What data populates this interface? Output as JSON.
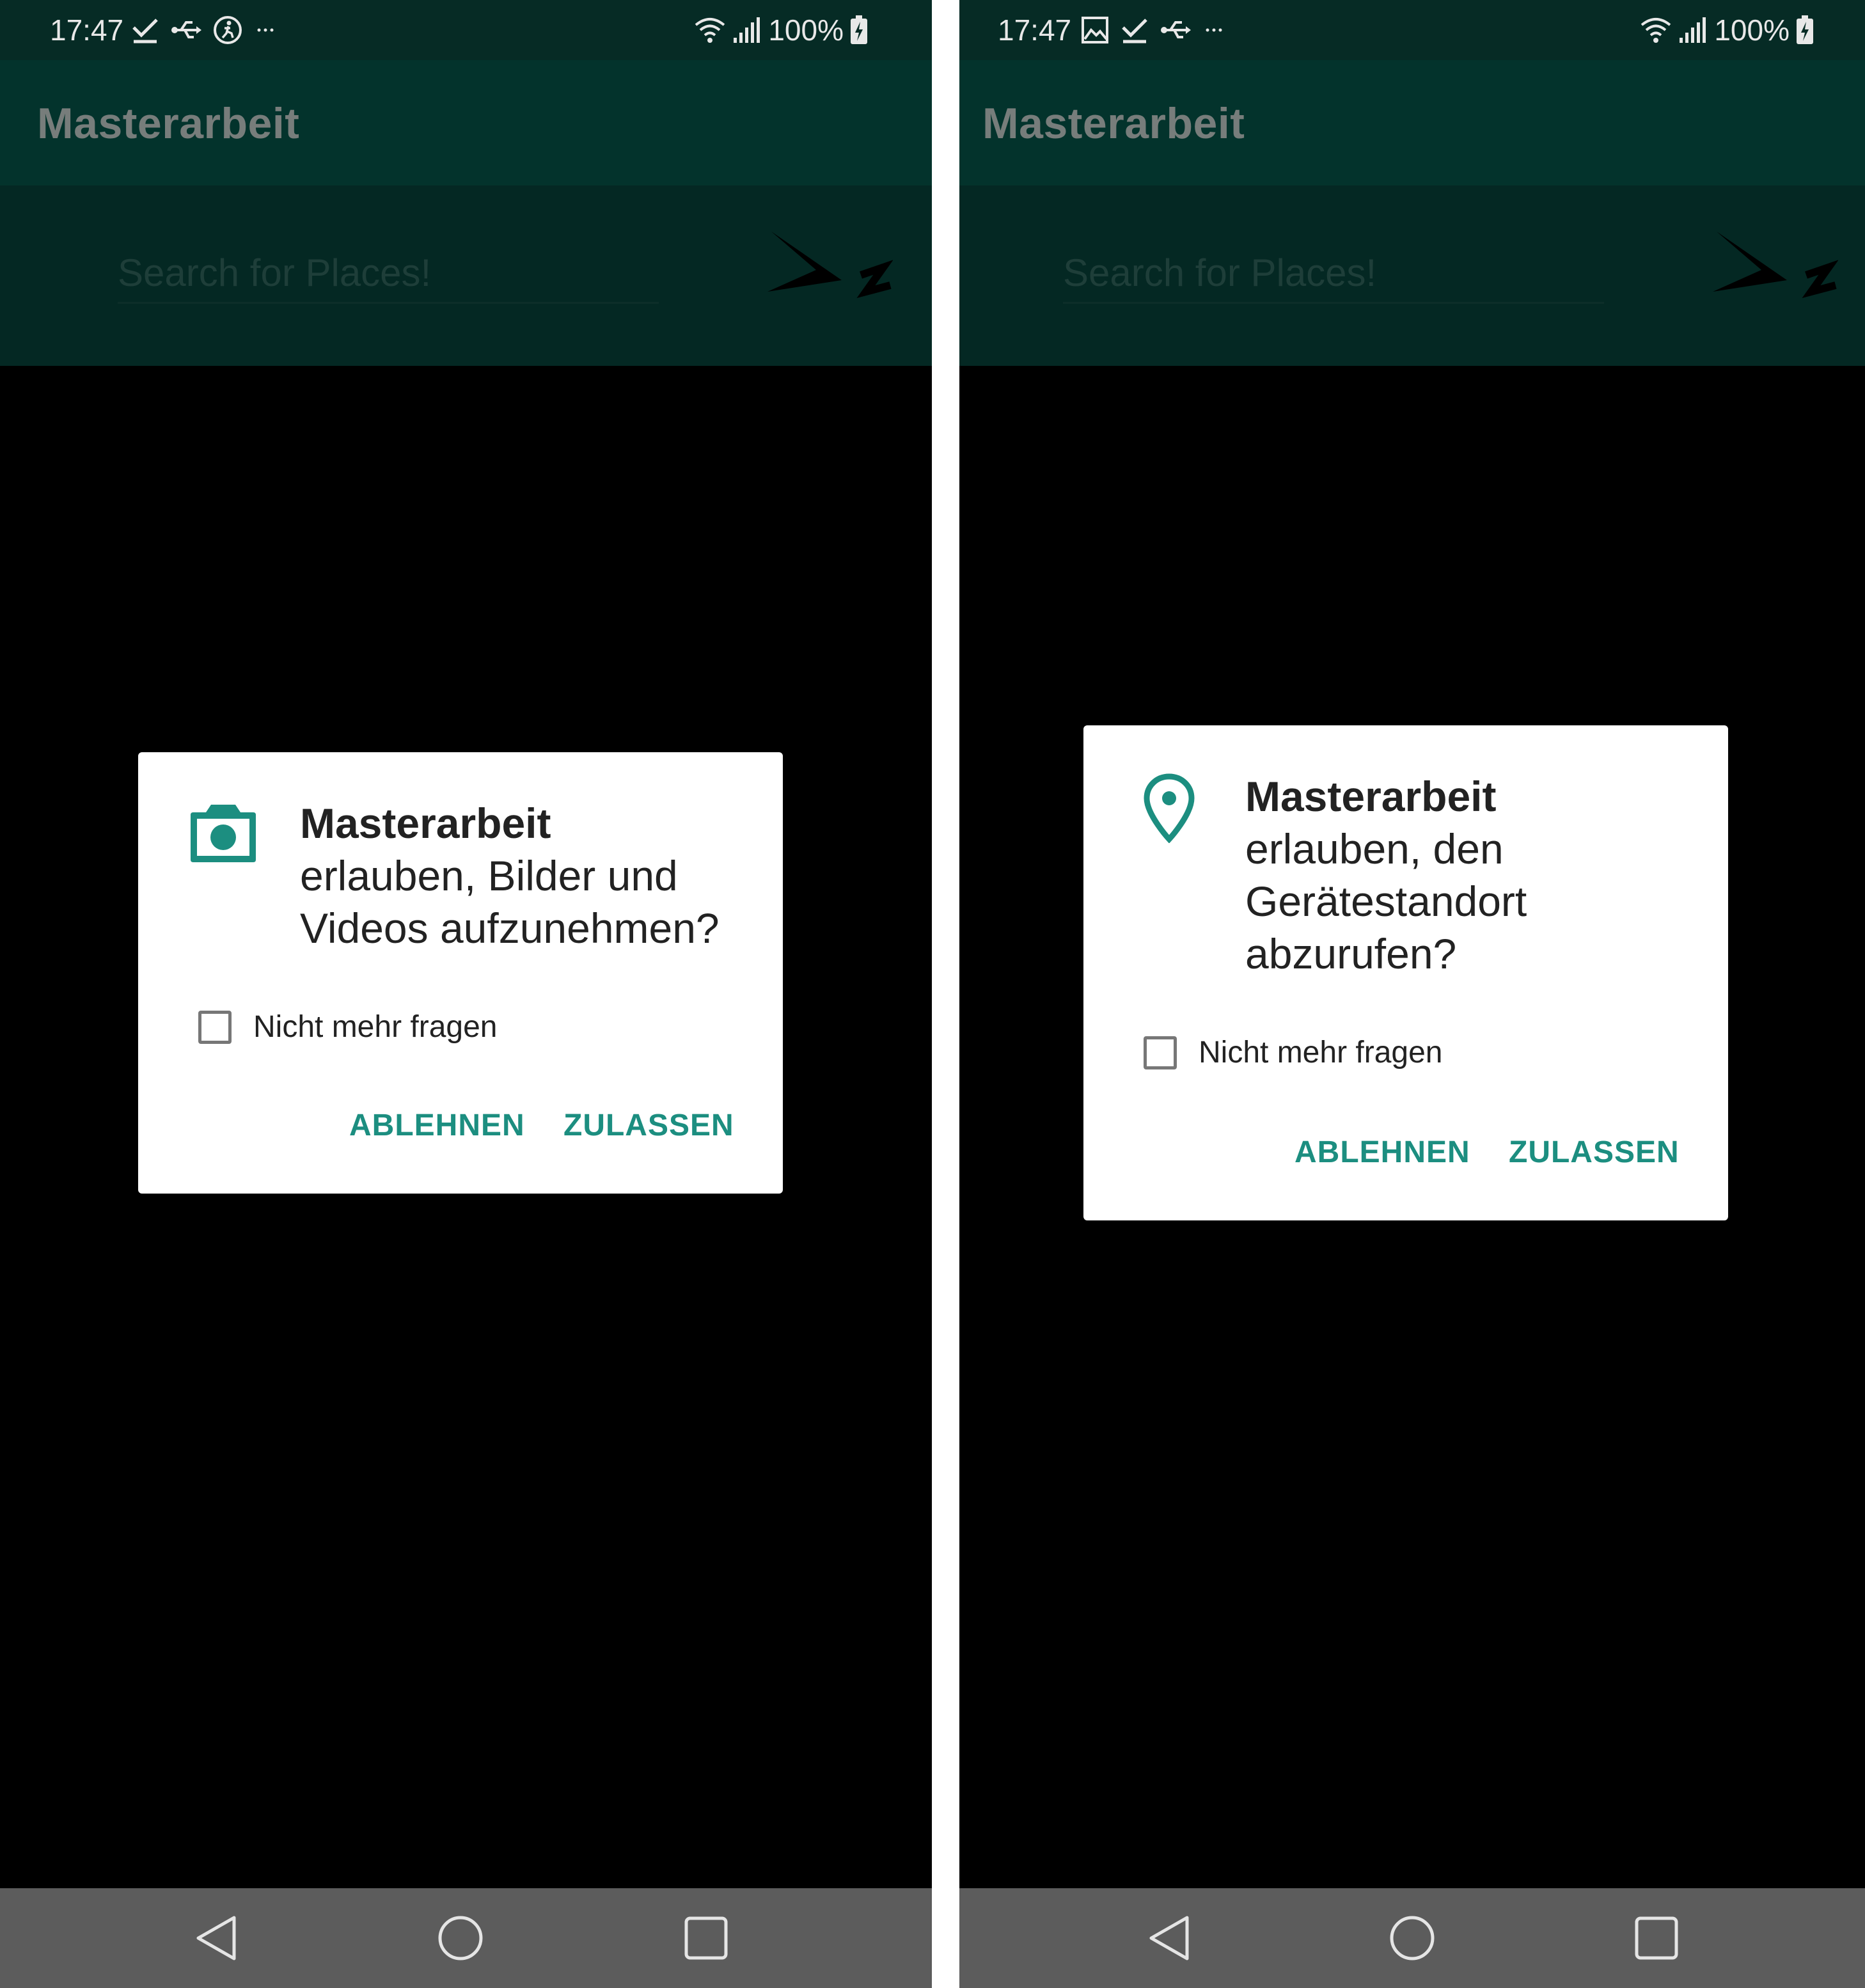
{
  "screens": [
    {
      "status": {
        "time": "17:47",
        "battery": "100%",
        "left_icons": [
          "check-download-icon",
          "usb-icon",
          "accessibility-icon",
          "more-dots-icon"
        ]
      },
      "app": {
        "title": "Masterarbeit",
        "search_placeholder": "Search for Places!"
      },
      "dialog": {
        "icon": "camera-icon",
        "app_name": "Masterarbeit",
        "message": "erlauben, Bilder und Videos aufzunehmen?",
        "checkbox_label": "Nicht mehr fragen",
        "checkbox_checked": false,
        "deny_label": "ABLEHNEN",
        "allow_label": "ZULASSEN"
      }
    },
    {
      "status": {
        "time": "17:47",
        "battery": "100%",
        "left_icons": [
          "image-icon",
          "check-download-icon",
          "usb-icon",
          "more-dots-icon"
        ]
      },
      "app": {
        "title": "Masterarbeit",
        "search_placeholder": "Search for Places!"
      },
      "dialog": {
        "icon": "location-pin-icon",
        "app_name": "Masterarbeit",
        "message": "erlauben, den Gerätestandort abzurufen?",
        "checkbox_label": "Nicht mehr fragen",
        "checkbox_checked": false,
        "deny_label": "ABLEHNEN",
        "allow_label": "ZULASSEN"
      }
    }
  ],
  "colors": {
    "status_bar": "#062b25",
    "app_bar": "#03332c",
    "accent": "#1c8e80",
    "nav_bar": "#5c5c5c"
  }
}
